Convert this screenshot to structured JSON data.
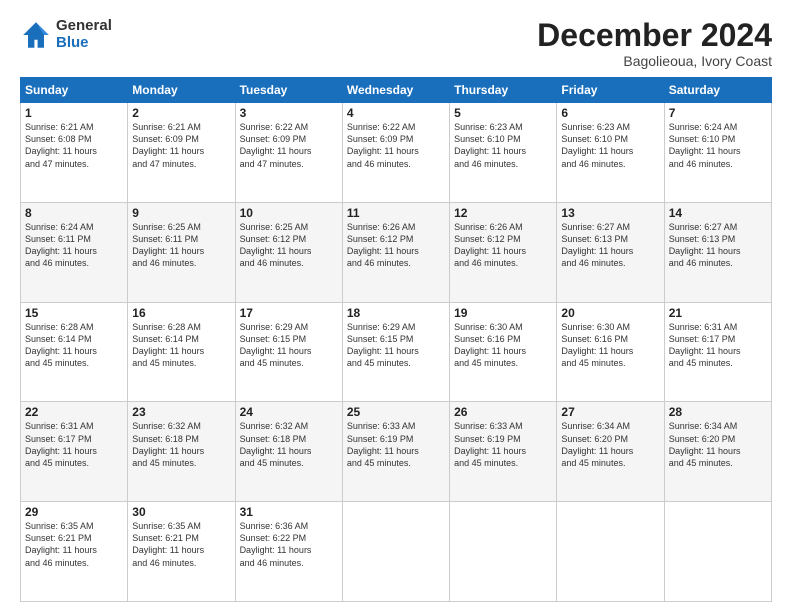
{
  "logo": {
    "general": "General",
    "blue": "Blue"
  },
  "title": "December 2024",
  "subtitle": "Bagolieoua, Ivory Coast",
  "days_header": [
    "Sunday",
    "Monday",
    "Tuesday",
    "Wednesday",
    "Thursday",
    "Friday",
    "Saturday"
  ],
  "weeks": [
    [
      {
        "day": "1",
        "info": "Sunrise: 6:21 AM\nSunset: 6:08 PM\nDaylight: 11 hours\nand 47 minutes."
      },
      {
        "day": "2",
        "info": "Sunrise: 6:21 AM\nSunset: 6:09 PM\nDaylight: 11 hours\nand 47 minutes."
      },
      {
        "day": "3",
        "info": "Sunrise: 6:22 AM\nSunset: 6:09 PM\nDaylight: 11 hours\nand 47 minutes."
      },
      {
        "day": "4",
        "info": "Sunrise: 6:22 AM\nSunset: 6:09 PM\nDaylight: 11 hours\nand 46 minutes."
      },
      {
        "day": "5",
        "info": "Sunrise: 6:23 AM\nSunset: 6:10 PM\nDaylight: 11 hours\nand 46 minutes."
      },
      {
        "day": "6",
        "info": "Sunrise: 6:23 AM\nSunset: 6:10 PM\nDaylight: 11 hours\nand 46 minutes."
      },
      {
        "day": "7",
        "info": "Sunrise: 6:24 AM\nSunset: 6:10 PM\nDaylight: 11 hours\nand 46 minutes."
      }
    ],
    [
      {
        "day": "8",
        "info": "Sunrise: 6:24 AM\nSunset: 6:11 PM\nDaylight: 11 hours\nand 46 minutes."
      },
      {
        "day": "9",
        "info": "Sunrise: 6:25 AM\nSunset: 6:11 PM\nDaylight: 11 hours\nand 46 minutes."
      },
      {
        "day": "10",
        "info": "Sunrise: 6:25 AM\nSunset: 6:12 PM\nDaylight: 11 hours\nand 46 minutes."
      },
      {
        "day": "11",
        "info": "Sunrise: 6:26 AM\nSunset: 6:12 PM\nDaylight: 11 hours\nand 46 minutes."
      },
      {
        "day": "12",
        "info": "Sunrise: 6:26 AM\nSunset: 6:12 PM\nDaylight: 11 hours\nand 46 minutes."
      },
      {
        "day": "13",
        "info": "Sunrise: 6:27 AM\nSunset: 6:13 PM\nDaylight: 11 hours\nand 46 minutes."
      },
      {
        "day": "14",
        "info": "Sunrise: 6:27 AM\nSunset: 6:13 PM\nDaylight: 11 hours\nand 46 minutes."
      }
    ],
    [
      {
        "day": "15",
        "info": "Sunrise: 6:28 AM\nSunset: 6:14 PM\nDaylight: 11 hours\nand 45 minutes."
      },
      {
        "day": "16",
        "info": "Sunrise: 6:28 AM\nSunset: 6:14 PM\nDaylight: 11 hours\nand 45 minutes."
      },
      {
        "day": "17",
        "info": "Sunrise: 6:29 AM\nSunset: 6:15 PM\nDaylight: 11 hours\nand 45 minutes."
      },
      {
        "day": "18",
        "info": "Sunrise: 6:29 AM\nSunset: 6:15 PM\nDaylight: 11 hours\nand 45 minutes."
      },
      {
        "day": "19",
        "info": "Sunrise: 6:30 AM\nSunset: 6:16 PM\nDaylight: 11 hours\nand 45 minutes."
      },
      {
        "day": "20",
        "info": "Sunrise: 6:30 AM\nSunset: 6:16 PM\nDaylight: 11 hours\nand 45 minutes."
      },
      {
        "day": "21",
        "info": "Sunrise: 6:31 AM\nSunset: 6:17 PM\nDaylight: 11 hours\nand 45 minutes."
      }
    ],
    [
      {
        "day": "22",
        "info": "Sunrise: 6:31 AM\nSunset: 6:17 PM\nDaylight: 11 hours\nand 45 minutes."
      },
      {
        "day": "23",
        "info": "Sunrise: 6:32 AM\nSunset: 6:18 PM\nDaylight: 11 hours\nand 45 minutes."
      },
      {
        "day": "24",
        "info": "Sunrise: 6:32 AM\nSunset: 6:18 PM\nDaylight: 11 hours\nand 45 minutes."
      },
      {
        "day": "25",
        "info": "Sunrise: 6:33 AM\nSunset: 6:19 PM\nDaylight: 11 hours\nand 45 minutes."
      },
      {
        "day": "26",
        "info": "Sunrise: 6:33 AM\nSunset: 6:19 PM\nDaylight: 11 hours\nand 45 minutes."
      },
      {
        "day": "27",
        "info": "Sunrise: 6:34 AM\nSunset: 6:20 PM\nDaylight: 11 hours\nand 45 minutes."
      },
      {
        "day": "28",
        "info": "Sunrise: 6:34 AM\nSunset: 6:20 PM\nDaylight: 11 hours\nand 45 minutes."
      }
    ],
    [
      {
        "day": "29",
        "info": "Sunrise: 6:35 AM\nSunset: 6:21 PM\nDaylight: 11 hours\nand 46 minutes."
      },
      {
        "day": "30",
        "info": "Sunrise: 6:35 AM\nSunset: 6:21 PM\nDaylight: 11 hours\nand 46 minutes."
      },
      {
        "day": "31",
        "info": "Sunrise: 6:36 AM\nSunset: 6:22 PM\nDaylight: 11 hours\nand 46 minutes."
      },
      null,
      null,
      null,
      null
    ]
  ]
}
